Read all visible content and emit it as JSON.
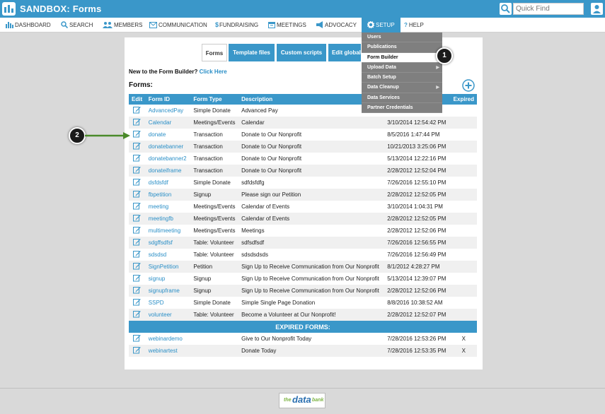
{
  "app": {
    "title": "SANDBOX: Forms"
  },
  "quick_find": {
    "placeholder": "Quick Find"
  },
  "nav": [
    {
      "label": "DASHBOARD",
      "icon": "chart-icon"
    },
    {
      "label": "SEARCH",
      "icon": "search-icon"
    },
    {
      "label": "MEMBERS",
      "icon": "members-icon"
    },
    {
      "label": "COMMUNICATION",
      "icon": "envelope-icon"
    },
    {
      "label": "FUNDRAISING",
      "icon": "dollar-icon"
    },
    {
      "label": "MEETINGS",
      "icon": "calendar-icon"
    },
    {
      "label": "ADVOCACY",
      "icon": "megaphone-icon"
    },
    {
      "label": "SETUP",
      "icon": "gear-icon"
    },
    {
      "label": "HELP",
      "icon": "question-icon"
    }
  ],
  "tabs": [
    "Forms",
    "Template files",
    "Custom scripts",
    "Edit global"
  ],
  "intro": {
    "text": "New to the Form Builder?",
    "link": "Click Here"
  },
  "forms_heading": "Forms:",
  "table": {
    "headers": [
      "Edit",
      "Form ID",
      "Form Type",
      "Description",
      "",
      "Expired"
    ],
    "rows": [
      {
        "id": "AdvancedPay",
        "type": "Simple Donate",
        "desc": "Advanced Pay",
        "date": "",
        "expired": ""
      },
      {
        "id": "Calendar",
        "type": "Meetings/Events",
        "desc": "Calendar",
        "date": "3/10/2014 12:54:42 PM",
        "expired": ""
      },
      {
        "id": "donate",
        "type": "Transaction",
        "desc": "Donate to Our Nonprofit",
        "date": "8/5/2016 1:47:44 PM",
        "expired": ""
      },
      {
        "id": "donatebanner",
        "type": "Transaction",
        "desc": "Donate to Our Nonprofit",
        "date": "10/21/2013 3:25:06 PM",
        "expired": ""
      },
      {
        "id": "donatebanner2",
        "type": "Transaction",
        "desc": "Donate to Our Nonprofit",
        "date": "5/13/2014 12:22:16 PM",
        "expired": ""
      },
      {
        "id": "donateiframe",
        "type": "Transaction",
        "desc": "Donate to Our Nonprofit",
        "date": "2/28/2012 12:52:04 PM",
        "expired": ""
      },
      {
        "id": "dsfdsfdf",
        "type": "Simple Donate",
        "desc": "sdfdsfdfg",
        "date": "7/26/2016 12:55:10 PM",
        "expired": ""
      },
      {
        "id": "fbpetition",
        "type": "Signup",
        "desc": "Please sign our Petition",
        "date": "2/28/2012 12:52:05 PM",
        "expired": ""
      },
      {
        "id": "meeting",
        "type": "Meetings/Events",
        "desc": "Calendar of Events",
        "date": "3/10/2014 1:04:31 PM",
        "expired": ""
      },
      {
        "id": "meetingfb",
        "type": "Meetings/Events",
        "desc": "Calendar of Events",
        "date": "2/28/2012 12:52:05 PM",
        "expired": ""
      },
      {
        "id": "multimeeting",
        "type": "Meetings/Events",
        "desc": "Meetings",
        "date": "2/28/2012 12:52:06 PM",
        "expired": ""
      },
      {
        "id": "sdgffsdfsf",
        "type": "Table: Volunteer",
        "desc": "sdfsdfsdf",
        "date": "7/26/2016 12:56:55 PM",
        "expired": ""
      },
      {
        "id": "sdsdsd",
        "type": "Table: Volunteer",
        "desc": "sdsdsdsds",
        "date": "7/26/2016 12:56:49 PM",
        "expired": ""
      },
      {
        "id": "SignPetition",
        "type": "Petition",
        "desc": "Sign Up to Receive Communication from Our Nonprofit",
        "date": "8/1/2012 4:28:27 PM",
        "expired": ""
      },
      {
        "id": "signup",
        "type": "Signup",
        "desc": "Sign Up to Receive Communication from Our Nonprofit",
        "date": "5/13/2014 12:39:07 PM",
        "expired": ""
      },
      {
        "id": "signupframe",
        "type": "Signup",
        "desc": "Sign Up to Receive Communication from Our Nonprofit",
        "date": "2/28/2012 12:52:06 PM",
        "expired": ""
      },
      {
        "id": "SSPD",
        "type": "Simple Donate",
        "desc": "Simple Single Page Donation",
        "date": "8/8/2016 10:38:52 AM",
        "expired": ""
      },
      {
        "id": "volunteer",
        "type": "Table: Volunteer",
        "desc": "Become a Volunteer at Our Nonprofit!",
        "date": "2/28/2012 12:52:07 PM",
        "expired": ""
      }
    ],
    "expired_heading": "EXPIRED FORMS:",
    "expired_rows": [
      {
        "id": "webinardemo",
        "type": "",
        "desc": "Give to Our Nonprofit Today",
        "date": "7/28/2016 12:53:26 PM",
        "expired": "X"
      },
      {
        "id": "webinartest",
        "type": "",
        "desc": "Donate Today",
        "date": "7/28/2016 12:53:35 PM",
        "expired": "X"
      }
    ]
  },
  "setup_menu": [
    {
      "label": "Users"
    },
    {
      "label": "Publications"
    },
    {
      "label": "Form Builder",
      "active": true
    },
    {
      "label": "Upload Data",
      "submenu": true
    },
    {
      "label": "Batch Setup"
    },
    {
      "label": "Data Cleanup",
      "submenu": true
    },
    {
      "label": "Data Services"
    },
    {
      "label": "Partner Credentials"
    }
  ],
  "callouts": [
    "1",
    "2"
  ],
  "footer_logo": {
    "pre": "the",
    "main": "data",
    "post": "bank"
  },
  "colors": {
    "accent": "#3a97c9",
    "link": "#2a8fc7",
    "menu": "#7f7f7f",
    "callout_arrow": "#4a8a2a"
  }
}
